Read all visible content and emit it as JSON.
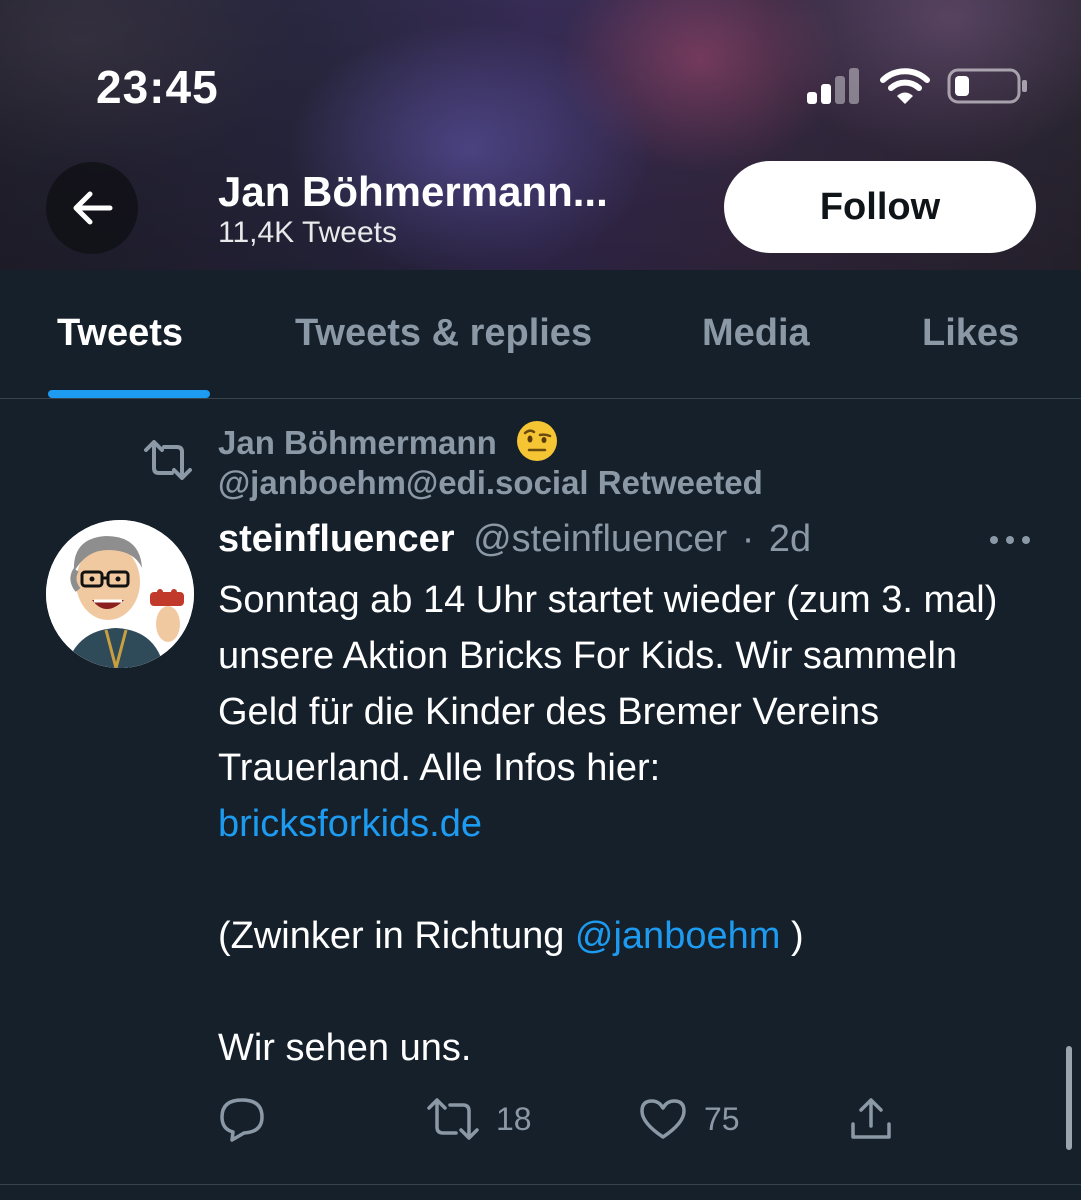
{
  "status_bar": {
    "time": "23:45",
    "icons": [
      "signal-icon",
      "wifi-icon",
      "battery-icon"
    ]
  },
  "header": {
    "back_icon": "arrow-left-icon",
    "name": "Jan Böhmermann...",
    "tweet_count": "11,4K Tweets",
    "follow_label": "Follow"
  },
  "tabs": [
    {
      "label": "Tweets",
      "active": true
    },
    {
      "label": "Tweets & replies",
      "active": false
    },
    {
      "label": "Media",
      "active": false
    },
    {
      "label": "Likes",
      "active": false
    }
  ],
  "tweet": {
    "retweet_context": {
      "icon": "retweet-icon",
      "name": "Jan Böhmermann",
      "emoji": "face-with-raised-eyebrow-emoji",
      "line2": "@janboehm@edi.social Retweeted"
    },
    "author": {
      "name": "steinfluencer",
      "handle": "@steinfluencer",
      "separator": "·",
      "time": "2d"
    },
    "text": {
      "line1": "Sonntag ab 14 Uhr startet wieder (zum 3. mal) unsere Aktion Bricks For Kids. Wir sammeln Geld für die Kinder des Bremer Vereins Trauerland. Alle Infos hier:",
      "link": "bricksforkids.de",
      "wink_prefix": "(Zwinker in Richtung ",
      "mention": "@janboehm",
      "wink_suffix": " )",
      "closing": "Wir sehen uns."
    },
    "actions": {
      "reply": {
        "icon": "reply-icon",
        "count": ""
      },
      "retweet": {
        "icon": "retweet-icon",
        "count": "18"
      },
      "like": {
        "icon": "heart-icon",
        "count": "75"
      },
      "share": {
        "icon": "share-icon",
        "count": ""
      }
    }
  },
  "colors": {
    "background": "#15202b",
    "accent": "#1d9bf0",
    "secondary_text": "#8b98a5",
    "divider": "#38444d"
  }
}
